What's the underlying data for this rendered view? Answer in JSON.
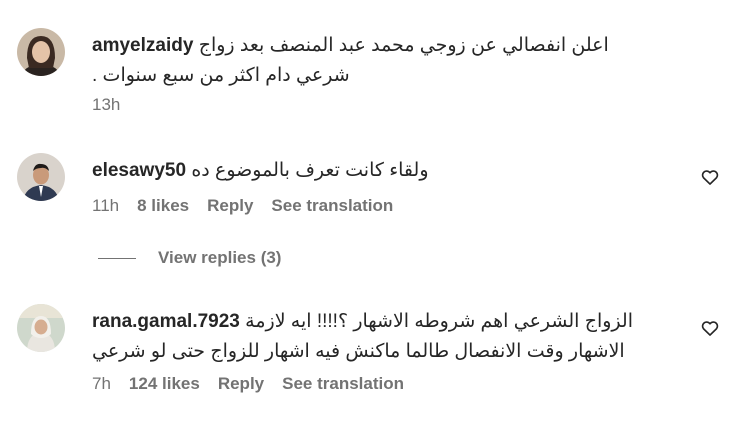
{
  "comments": [
    {
      "username": "amyelzaidy",
      "text_line1": "اعلن انفصالي عن زوجي محمد عبد المنصف بعد زواج",
      "text_line2": "شرعي دام اكثر من سبع سنوات .",
      "time": "13h"
    },
    {
      "username": "elesawy50",
      "text_line1": "ولقاء كانت تعرف بالموضوع ده",
      "time": "11h",
      "likes": "8 likes",
      "reply_label": "Reply",
      "translate_label": "See translation",
      "view_replies": "View replies (3)"
    },
    {
      "username": "rana.gamal.7923",
      "text_line1": "الزواج الشرعي اهم شروطه الاشهار ؟!!!! ايه لازمة",
      "text_line2": "الاشهار وقت الانفصال طالما ماكنش فيه اشهار للزواج حتى لو شرعي",
      "time": "7h",
      "likes": "124 likes",
      "reply_label": "Reply",
      "translate_label": "See translation"
    }
  ],
  "icons": {
    "like": "heart-outline-icon"
  },
  "colors": {
    "text": "#262626",
    "secondary": "#737373",
    "background": "#ffffff"
  }
}
